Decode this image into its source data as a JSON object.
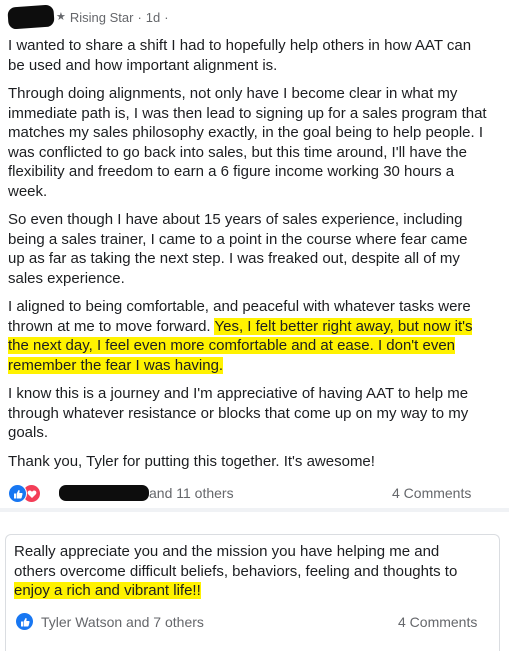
{
  "post": {
    "badge": "Rising Star",
    "time": "1d",
    "paragraphs": [
      "I wanted to share a shift I had to hopefully help others in how AAT can be used and how important alignment is.",
      "Through doing alignments, not only have I become clear in what my immediate path is, I was then lead to signing up for a sales program that matches my sales philosophy exactly, in the goal being to help people.  I was conflicted to go back into sales, but this time around, I'll have the flexibility and freedom to earn a 6 figure income working 30 hours a week.",
      "So even though I have about 15 years of sales experience, including being a sales trainer, I came to a point in the course where fear came up as far as taking the next step.  I was freaked out, despite all of my sales experience."
    ],
    "p4_plain": "I aligned to being comfortable, and peaceful with whatever tasks were thrown at me to move forward. ",
    "p4_highlight": "Yes, I felt better right away, but now it's the next day, I feel even more comfortable and at ease.  I don't even remember the fear I was having.",
    "p5": "I know this is a journey and I'm appreciative of having AAT to help me through whatever resistance or blocks that come up on my way to my goals.",
    "p6": "Thank you, Tyler for putting this together.  It's awesome!",
    "reactions": "and 11 others",
    "comments": "4 Comments"
  },
  "comment_post": {
    "text_plain": "Really appreciate you and the mission you have helping me and others overcome difficult beliefs, behaviors, feeling and thoughts to ",
    "text_highlight": "enjoy a rich and vibrant life!!",
    "reactions": "Tyler Watson and 7 others",
    "comments": "4 Comments"
  },
  "colors": {
    "highlight": "#fff200",
    "like": "#1877f2",
    "love": "#f33e58"
  },
  "icons": [
    "star-icon",
    "like-icon",
    "love-icon"
  ]
}
